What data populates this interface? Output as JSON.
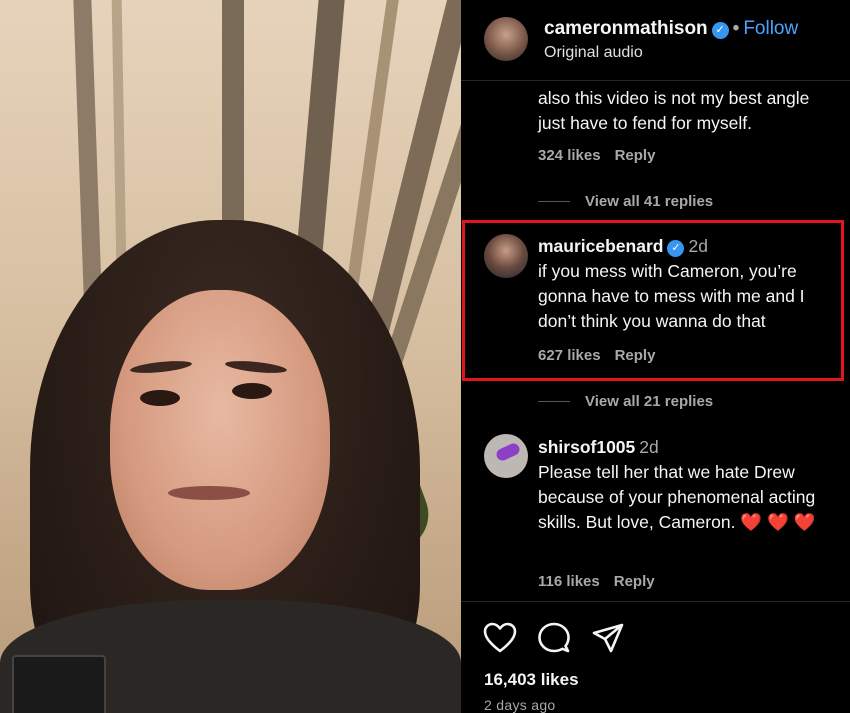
{
  "header": {
    "username": "cameronmathison",
    "separator": "•",
    "follow_label": "Follow",
    "subtitle": "Original audio",
    "verified_icon": "verified-badge-icon"
  },
  "comment_partial": {
    "text": "also this video is not my best angle just have to fend for myself.",
    "likes": "324 likes",
    "reply_label": "Reply",
    "view_replies": "View all 41 replies"
  },
  "comment_highlighted": {
    "username": "mauricebenard",
    "time": "2d",
    "text": "if you mess with Cameron, you’re gonna have to mess with me and I don’t think you wanna do that",
    "likes": "627 likes",
    "reply_label": "Reply",
    "view_replies": "View all 21 replies"
  },
  "comment_third": {
    "username": "shirsof1005",
    "time": "2d",
    "text": "Please tell her that we hate Drew because of your phenomenal acting skills. But love, Cameron.",
    "hearts": "❤️ ❤️ ❤️",
    "likes": "116 likes",
    "reply_label": "Reply"
  },
  "footer": {
    "likes": "16,403 likes",
    "posted": "2 days ago",
    "icons": [
      "heart-icon",
      "comment-icon",
      "share-icon"
    ]
  },
  "colors": {
    "follow_blue": "#4aa3ff",
    "verified_blue": "#3797f0",
    "highlight_red": "#e0161b",
    "heart_red": "#ff2d3f"
  }
}
